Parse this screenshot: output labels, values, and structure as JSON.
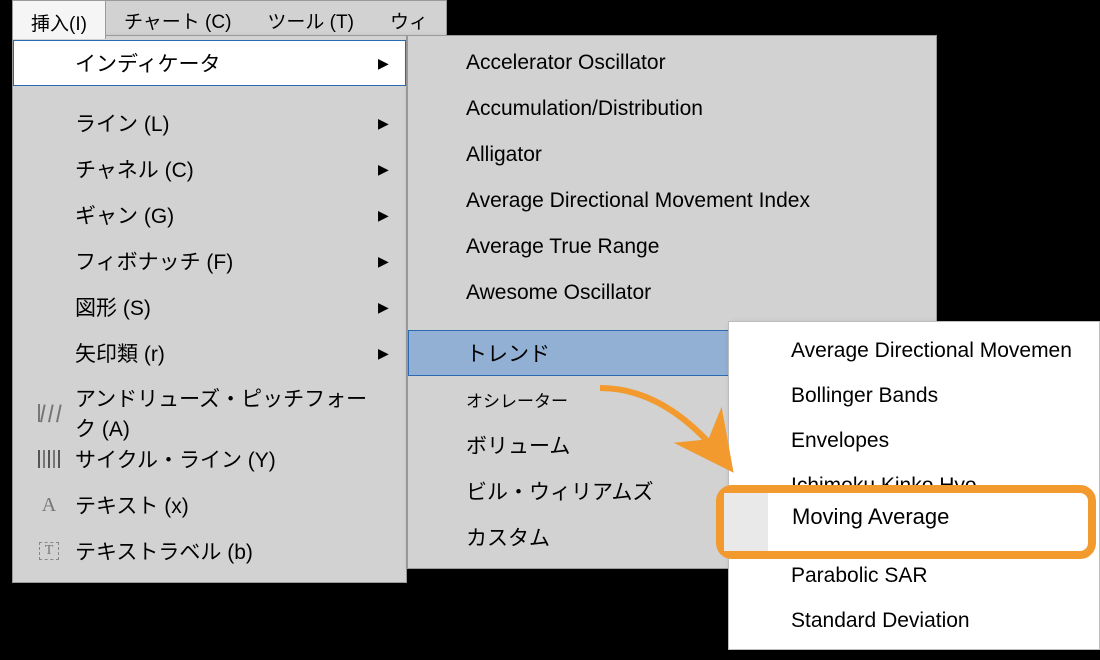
{
  "menubar": {
    "items": [
      {
        "label": "挿入(I)"
      },
      {
        "label": "チャート (C)"
      },
      {
        "label": "ツール (T)"
      },
      {
        "label": "ウィ"
      }
    ]
  },
  "level1": {
    "indicators": "インディケータ",
    "line": "ライン (L)",
    "channel": "チャネル (C)",
    "gann": "ギャン (G)",
    "fibonacci": "フィボナッチ (F)",
    "shapes": "図形 (S)",
    "arrows": "矢印類 (r)",
    "pitchfork": "アンドリューズ・ピッチフォーク (A)",
    "cycle": "サイクル・ライン (Y)",
    "text": "テキスト (x)",
    "textlabel": "テキストラベル (b)"
  },
  "level2": {
    "accelerator": "Accelerator Oscillator",
    "accdist": "Accumulation/Distribution",
    "alligator": "Alligator",
    "adx": "Average Directional Movement Index",
    "atr": "Average True Range",
    "awesome": "Awesome Oscillator",
    "trend": "トレンド",
    "oscillator": "オシレーター",
    "volume": "ボリューム",
    "billwilliams": "ビル・ウィリアムズ",
    "custom": "カスタム"
  },
  "level3": {
    "adx": "Average Directional Movemen",
    "bollinger": "Bollinger Bands",
    "envelopes": "Envelopes",
    "ichimoku": "Ichimoku Kinko Hyo",
    "ma": "Moving Average",
    "parabolic": "Parabolic SAR",
    "stddev": "Standard Deviation"
  }
}
